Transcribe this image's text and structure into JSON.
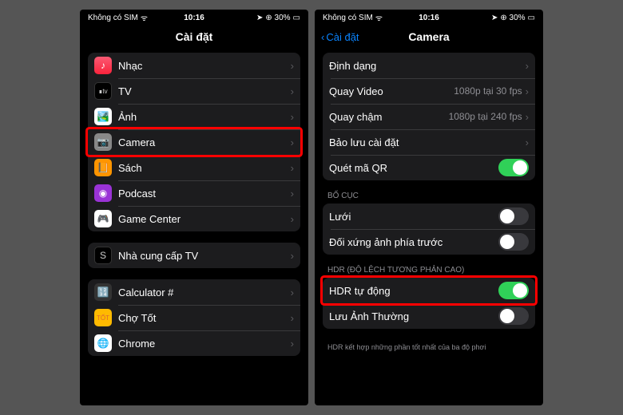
{
  "status": {
    "carrier": "Không có SIM",
    "time": "10:16",
    "battery": "30%"
  },
  "left": {
    "title": "Cài đặt",
    "group1": [
      {
        "label": "Nhạc"
      },
      {
        "label": "TV"
      },
      {
        "label": "Ảnh"
      },
      {
        "label": "Camera"
      },
      {
        "label": "Sách"
      },
      {
        "label": "Podcast"
      },
      {
        "label": "Game Center"
      }
    ],
    "group2": [
      {
        "label": "Nhà cung cấp TV"
      }
    ],
    "group3": [
      {
        "label": "Calculator #"
      },
      {
        "label": "Chợ Tốt"
      },
      {
        "label": "Chrome"
      }
    ]
  },
  "right": {
    "back": "Cài đặt",
    "title": "Camera",
    "group1": [
      {
        "label": "Định dạng",
        "detail": ""
      },
      {
        "label": "Quay Video",
        "detail": "1080p tại 30 fps"
      },
      {
        "label": "Quay chậm",
        "detail": "1080p tại 240 fps"
      },
      {
        "label": "Bảo lưu cài đặt",
        "detail": ""
      },
      {
        "label": "Quét mã QR",
        "toggle": true
      }
    ],
    "section2_title": "BỐ CỤC",
    "group2": [
      {
        "label": "Lưới",
        "toggle": false
      },
      {
        "label": "Đối xứng ảnh phía trước",
        "toggle": false
      }
    ],
    "section3_title": "HDR (ĐỘ LỆCH TƯƠNG PHẢN CAO)",
    "group3": [
      {
        "label": "HDR tự động",
        "toggle": true
      },
      {
        "label": "Lưu Ảnh Thường",
        "toggle": false
      }
    ],
    "footer": "HDR kết hợp những phần tốt nhất của ba độ phơi"
  }
}
